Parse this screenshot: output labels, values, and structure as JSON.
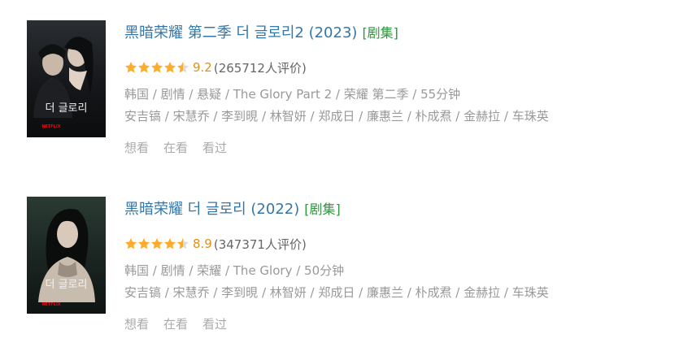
{
  "results": [
    {
      "title": "黑暗荣耀 第二季 더 글로리2 (2023)",
      "type_tag": "[剧集]",
      "rating_stars": 4.5,
      "score": "9.2",
      "votes": "(265712人评价)",
      "genres": "韩国 / 剧情 / 悬疑 / The Glory Part 2 / 荣耀 第二季 / 55分钟",
      "cast": "安吉镐 / 宋慧乔 / 李到晛 / 林智妍 / 郑成日 / 廉惠兰 / 朴成焄 / 金赫拉 / 车珠英",
      "actions": [
        "想看",
        "在看",
        "看过"
      ],
      "poster": {
        "text": "더 글로리",
        "brand": "NETFLIX"
      }
    },
    {
      "title": "黑暗荣耀 더 글로리 (2022)",
      "type_tag": "[剧集]",
      "rating_stars": 4.5,
      "score": "8.9",
      "votes": "(347371人评价)",
      "genres": "韩国 / 剧情 / 荣耀 / The Glory / 50分钟",
      "cast": "安吉镐 / 宋慧乔 / 李到晛 / 林智妍 / 郑成日 / 廉惠兰 / 朴成焄 / 金赫拉 / 车珠英",
      "actions": [
        "想看",
        "在看",
        "看过"
      ],
      "poster": {
        "text": "더 글로리",
        "brand": "NETFLIX"
      }
    }
  ],
  "colors": {
    "title_link": "#3377aa",
    "type_tag": "#2e963d",
    "star": "#ffac2d",
    "score": "#e09015",
    "meta": "#999999"
  }
}
